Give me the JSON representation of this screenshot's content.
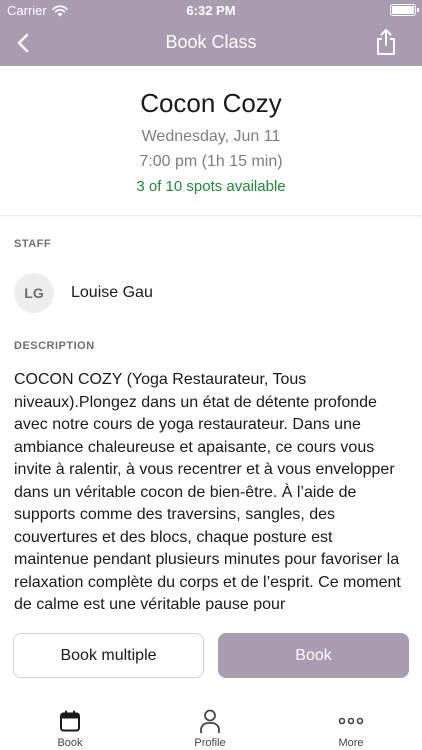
{
  "status_bar": {
    "carrier": "Carrier",
    "time": "6:32 PM"
  },
  "nav": {
    "title": "Book Class",
    "back_icon": "chevron-left-icon",
    "share_icon": "share-icon"
  },
  "class_info": {
    "name": "Cocon Cozy",
    "date": "Wednesday, Jun 11",
    "time": "7:00 pm (1h 15 min)",
    "spots": "3 of 10 spots available"
  },
  "staff": {
    "label": "STAFF",
    "initials": "LG",
    "name": "Louise Gau"
  },
  "description": {
    "label": "DESCRIPTION",
    "text": "COCON COZY (Yoga Restaurateur, Tous niveaux).Plongez dans un état de détente profonde avec notre cours de yoga restaurateur. Dans une ambiance chaleureuse et apaisante, ce cours vous invite à ralentir, à vous recentrer et à vous envelopper dans un véritable cocon de bien-être. À l’aide de supports comme des traversins, sangles, des couvertures et des blocs, chaque posture est maintenue pendant plusieurs minutes pour favoriser la relaxation complète du corps et de l’esprit. Ce moment de calme est une véritable pause pour"
  },
  "actions": {
    "book_multiple": "Book multiple",
    "book": "Book"
  },
  "tabbar": {
    "items": [
      {
        "label": "Book",
        "icon": "calendar-icon"
      },
      {
        "label": "Profile",
        "icon": "person-icon"
      },
      {
        "label": "More",
        "icon": "more-dots-icon"
      }
    ]
  },
  "colors": {
    "brand": "#a99cb1",
    "spots_available": "#1e8a37"
  }
}
